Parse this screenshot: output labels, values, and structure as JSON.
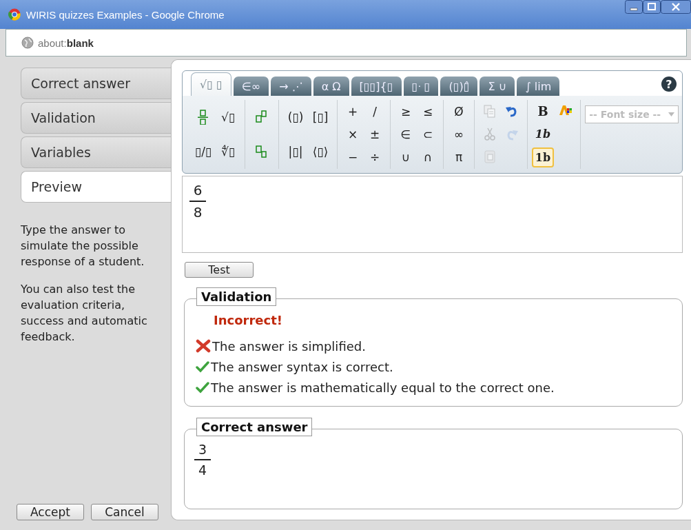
{
  "window": {
    "title": "WIRIS quizzes Examples - Google Chrome"
  },
  "address_bar": {
    "scheme": "about:",
    "path": "blank"
  },
  "side_tabs": [
    {
      "label": "Correct answer",
      "selected": false
    },
    {
      "label": "Validation",
      "selected": false
    },
    {
      "label": "Variables",
      "selected": false
    },
    {
      "label": "Preview",
      "selected": true
    }
  ],
  "help_text": [
    "Type the answer to simulate the possible response of a student.",
    "You can also test the evaluation criteria, success and automatic feedback."
  ],
  "buttons": [
    "Accept",
    "Cancel"
  ],
  "editor": {
    "toolbar_tabs": [
      {
        "label": "√▯ ▯",
        "selected": true
      },
      {
        "label": "∈∞",
        "selected": false
      },
      {
        "label": "→ ⋰",
        "selected": false
      },
      {
        "label": "α Ω",
        "selected": false
      },
      {
        "label": "[▯▯]{▯",
        "selected": false
      },
      {
        "label": "▯ᐧ ▯",
        "selected": false
      },
      {
        "label": "(▯)▯̂",
        "selected": false
      },
      {
        "label": "Σ ∪",
        "selected": false
      },
      {
        "label": "∫ lim",
        "selected": false
      }
    ],
    "help_button": "?",
    "palette": [
      [
        [
          {
            "kind": "fraction"
          },
          {
            "kind": "template",
            "label": "▯/▯"
          }
        ],
        [
          {
            "kind": "template",
            "label": "√▯"
          },
          {
            "kind": "template",
            "label": "∜▯"
          }
        ]
      ],
      [
        [
          {
            "kind": "superscript"
          },
          {
            "kind": "subscript"
          }
        ]
      ],
      [
        [
          {
            "kind": "template",
            "label": "(▯)"
          },
          {
            "kind": "template",
            "label": "|▯|"
          }
        ],
        [
          {
            "kind": "template",
            "label": "[▯]"
          },
          {
            "kind": "template",
            "label": "⟨▯⟩"
          }
        ]
      ],
      [
        [
          {
            "kind": "symbol",
            "label": "+"
          },
          {
            "kind": "symbol",
            "label": "×"
          },
          {
            "kind": "symbol",
            "label": "−"
          }
        ],
        [
          {
            "kind": "symbol",
            "label": "/"
          },
          {
            "kind": "symbol",
            "label": "±"
          },
          {
            "kind": "symbol",
            "label": "÷"
          }
        ]
      ],
      [
        [
          {
            "kind": "symbol",
            "label": "≥"
          },
          {
            "kind": "symbol",
            "label": "∈"
          },
          {
            "kind": "symbol",
            "label": "∪"
          }
        ],
        [
          {
            "kind": "symbol",
            "label": "≤"
          },
          {
            "kind": "symbol",
            "label": "⊂"
          },
          {
            "kind": "symbol",
            "label": "∩"
          }
        ]
      ],
      [
        [
          {
            "kind": "symbol",
            "label": "Ø"
          },
          {
            "kind": "symbol",
            "label": "∞"
          },
          {
            "kind": "symbol",
            "label": "π"
          }
        ]
      ],
      [
        [
          {
            "kind": "copy",
            "disabled": true
          },
          {
            "kind": "cut",
            "disabled": true
          },
          {
            "kind": "paste",
            "disabled": true
          }
        ],
        [
          {
            "kind": "undo",
            "disabled": false
          },
          {
            "kind": "redo",
            "disabled": true
          }
        ]
      ],
      [
        [
          {
            "kind": "bold",
            "label": "B"
          },
          {
            "kind": "style",
            "label": "1b",
            "selected": false
          },
          {
            "kind": "style",
            "label": "1b",
            "selected": true
          }
        ],
        [
          {
            "kind": "color"
          }
        ]
      ]
    ],
    "font_size": {
      "label": "-- Font size --",
      "disabled": true
    },
    "answer": {
      "numerator": "6",
      "denominator": "8"
    }
  },
  "test_button": "Test",
  "validation": {
    "legend": "Validation",
    "verdict": "Incorrect!",
    "checks": [
      {
        "text": "The answer is simplified.",
        "passed": false
      },
      {
        "text": "The answer syntax is correct.",
        "passed": true
      },
      {
        "text": "The answer is mathematically equal to the correct one.",
        "passed": true
      }
    ]
  },
  "correct_answer": {
    "legend": "Correct answer",
    "numerator": "3",
    "denominator": "4"
  }
}
